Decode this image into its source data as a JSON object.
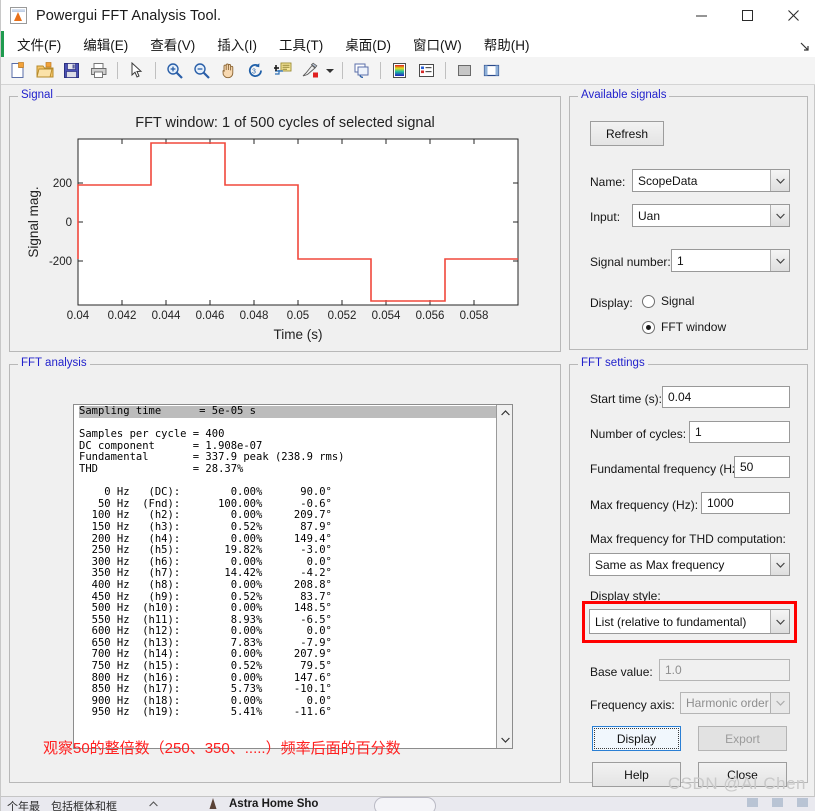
{
  "window": {
    "title": "Powergui FFT Analysis Tool.",
    "icon": "matlab-figure-icon",
    "minimize_label": "—",
    "maximize_label": "□",
    "close_label": "✕",
    "resize_grip": "resize-grip-icon"
  },
  "menubar": {
    "items": [
      {
        "label": "文件(F)",
        "name": "menu-file"
      },
      {
        "label": "编辑(E)",
        "name": "menu-edit"
      },
      {
        "label": "查看(V)",
        "name": "menu-view"
      },
      {
        "label": "插入(I)",
        "name": "menu-insert"
      },
      {
        "label": "工具(T)",
        "name": "menu-tools"
      },
      {
        "label": "桌面(D)",
        "name": "menu-desktop"
      },
      {
        "label": "窗口(W)",
        "name": "menu-window"
      },
      {
        "label": "帮助(H)",
        "name": "menu-help"
      }
    ],
    "overflow": "»"
  },
  "toolbar": {
    "buttons": [
      "new-figure-icon",
      "open-file-icon",
      "save-icon",
      "print-icon",
      "pointer-icon",
      "zoom-in-icon",
      "zoom-out-icon",
      "pan-icon",
      "rotate-3d-icon",
      "data-cursor-icon",
      "brush-icon",
      "brush-dropdown-icon",
      "link-plot-icon",
      "colorbar-icon",
      "legend-icon",
      "hide-plot-tools-icon",
      "show-plot-tools-icon"
    ]
  },
  "signal_panel": {
    "legend": "Signal",
    "plot_title": "FFT window: 1 of 500 cycles of selected signal",
    "ylabel": "Signal mag.",
    "xlabel": "Time (s)"
  },
  "chart_data": {
    "type": "line",
    "title": "FFT window: 1 of 500 cycles of selected signal",
    "xlabel": "Time (s)",
    "ylabel": "Signal mag.",
    "xlim": [
      0.0399,
      0.06
    ],
    "ylim": [
      -430,
      430
    ],
    "xticks": [
      0.04,
      0.042,
      0.044,
      0.046,
      0.048,
      0.05,
      0.052,
      0.054,
      0.056,
      0.058
    ],
    "xtick_labels": [
      "0.04",
      "0.042",
      "0.044",
      "0.046",
      "0.048",
      "0.05",
      "0.052",
      "0.054",
      "0.056",
      "0.058"
    ],
    "yticks": [
      -200,
      0,
      200
    ],
    "ytick_labels": [
      "-200",
      "0",
      "200"
    ],
    "grid": false,
    "legend": "none",
    "series": [
      {
        "name": "Uan",
        "color": "#f0483c",
        "x": [
          0.04,
          0.04,
          0.04333,
          0.04333,
          0.04667,
          0.04667,
          0.05,
          0.05,
          0.05333,
          0.05333,
          0.05667,
          0.05667,
          0.06
        ],
        "y": [
          -190,
          190,
          190,
          380,
          380,
          190,
          190,
          -190,
          -190,
          -380,
          -380,
          -190,
          -190
        ],
        "description": "six-step square-wave (three-level inverter phase voltage) one fundamental cycle"
      }
    ]
  },
  "fft_analysis": {
    "legend": "FFT analysis",
    "summary": [
      {
        "key": "Sampling time",
        "value": "= 5e-05 s",
        "highlighted": true
      },
      {
        "key": "Samples per cycle",
        "value": "= 400",
        "highlighted": false
      },
      {
        "key": "DC component",
        "value": "= 1.908e-07",
        "highlighted": false
      },
      {
        "key": "Fundamental",
        "value": "= 337.9 peak (238.9 rms)",
        "highlighted": false
      },
      {
        "key": "THD",
        "value": "= 28.37%",
        "highlighted": false
      }
    ],
    "report_text": "Sampling time      = 5e-05 s\nSamples per cycle = 400\nDC component      = 1.908e-07\nFundamental       = 337.9 peak (238.9 rms)\nTHD               = 28.37%\n\n    0 Hz   (DC):        0.00%      90.0°\n   50 Hz  (Fnd):      100.00%      -0.6°\n  100 Hz   (h2):        0.00%     209.7°\n  150 Hz   (h3):        0.52%      87.9°\n  200 Hz   (h4):        0.00%     149.4°\n  250 Hz   (h5):       19.82%      -3.0°\n  300 Hz   (h6):        0.00%       0.0°\n  350 Hz   (h7):       14.42%      -4.2°\n  400 Hz   (h8):        0.00%     208.8°\n  450 Hz   (h9):        0.52%      83.7°\n  500 Hz  (h10):        0.00%     148.5°\n  550 Hz  (h11):        8.93%      -6.5°\n  600 Hz  (h12):        0.00%       0.0°\n  650 Hz  (h13):        7.83%      -7.9°\n  700 Hz  (h14):        0.00%     207.9°\n  750 Hz  (h15):        0.52%      79.5°\n  800 Hz  (h16):        0.00%     147.6°\n  850 Hz  (h17):        5.73%     -10.1°\n  900 Hz  (h18):        0.00%       0.0°\n  950 Hz  (h19):        5.41%     -11.6°",
    "harmonics": [
      {
        "freq": "0 Hz",
        "order": "(DC)",
        "mag": "0.00%",
        "phase": "90.0°"
      },
      {
        "freq": "50 Hz",
        "order": "(Fnd)",
        "mag": "100.00%",
        "phase": "-0.6°"
      },
      {
        "freq": "100 Hz",
        "order": "(h2)",
        "mag": "0.00%",
        "phase": "209.7°"
      },
      {
        "freq": "150 Hz",
        "order": "(h3)",
        "mag": "0.52%",
        "phase": "87.9°"
      },
      {
        "freq": "200 Hz",
        "order": "(h4)",
        "mag": "0.00%",
        "phase": "149.4°"
      },
      {
        "freq": "250 Hz",
        "order": "(h5)",
        "mag": "19.82%",
        "phase": "-3.0°"
      },
      {
        "freq": "300 Hz",
        "order": "(h6)",
        "mag": "0.00%",
        "phase": "0.0°"
      },
      {
        "freq": "350 Hz",
        "order": "(h7)",
        "mag": "14.42%",
        "phase": "-4.2°"
      },
      {
        "freq": "400 Hz",
        "order": "(h8)",
        "mag": "0.00%",
        "phase": "208.8°"
      },
      {
        "freq": "450 Hz",
        "order": "(h9)",
        "mag": "0.52%",
        "phase": "83.7°"
      },
      {
        "freq": "500 Hz",
        "order": "(h10)",
        "mag": "0.00%",
        "phase": "148.5°"
      },
      {
        "freq": "550 Hz",
        "order": "(h11)",
        "mag": "8.93%",
        "phase": "-6.5°"
      },
      {
        "freq": "600 Hz",
        "order": "(h12)",
        "mag": "0.00%",
        "phase": "0.0°"
      },
      {
        "freq": "650 Hz",
        "order": "(h13)",
        "mag": "7.83%",
        "phase": "-7.9°"
      },
      {
        "freq": "700 Hz",
        "order": "(h14)",
        "mag": "0.00%",
        "phase": "207.9°"
      },
      {
        "freq": "750 Hz",
        "order": "(h15)",
        "mag": "0.52%",
        "phase": "79.5°"
      },
      {
        "freq": "800 Hz",
        "order": "(h16)",
        "mag": "0.00%",
        "phase": "147.6°"
      },
      {
        "freq": "850 Hz",
        "order": "(h17)",
        "mag": "5.73%",
        "phase": "-10.1°"
      },
      {
        "freq": "900 Hz",
        "order": "(h18)",
        "mag": "0.00%",
        "phase": "0.0°"
      },
      {
        "freq": "950 Hz",
        "order": "(h19)",
        "mag": "5.41%",
        "phase": "-11.6°"
      }
    ],
    "annotation": "观察50的整倍数（250、350、.....）频率后面的百分数",
    "annotation_color": "#ff2020",
    "scroll_up_icon": "chevron-up-icon",
    "scroll_down_icon": "chevron-down-icon"
  },
  "available_signals": {
    "legend": "Available signals",
    "refresh_label": "Refresh",
    "name_label": "Name:",
    "name_value": "ScopeData",
    "input_label": "Input:",
    "input_value": "Uan",
    "signal_number_label": "Signal number:",
    "signal_number_value": "1",
    "display_label": "Display:",
    "display_options": [
      {
        "label": "Signal",
        "selected": false
      },
      {
        "label": "FFT window",
        "selected": true
      }
    ]
  },
  "fft_settings": {
    "legend": "FFT settings",
    "start_time_label": "Start time (s):",
    "start_time_value": "0.04",
    "cycles_label": "Number of cycles:",
    "cycles_value": "1",
    "fundamental_label": "Fundamental frequency (Hz):",
    "fundamental_value": "50",
    "max_freq_label": "Max frequency (Hz):",
    "max_freq_value": "1000",
    "max_freq_thd_label": "Max frequency for THD computation:",
    "max_freq_thd_value": "Same as Max frequency",
    "display_style_label": "Display style:",
    "display_style_value": "List (relative to fundamental)",
    "display_style_highlight_color": "#ff0000",
    "base_value_label": "Base value:",
    "base_value_value": "1.0",
    "freq_axis_label": "Frequency axis:",
    "freq_axis_value": "Harmonic order",
    "buttons": {
      "display": "Display",
      "export": "Export",
      "help": "Help",
      "close": "Close"
    }
  },
  "taskbar": {
    "left_text": "个年最　包括框体和框",
    "chevron": "⌃",
    "app_text": "Astra Home Sho",
    "icons": [
      "tray-icon-1",
      "tray-icon-2",
      "tray-icon-3"
    ]
  },
  "watermark": "CSDN @AI Chen"
}
